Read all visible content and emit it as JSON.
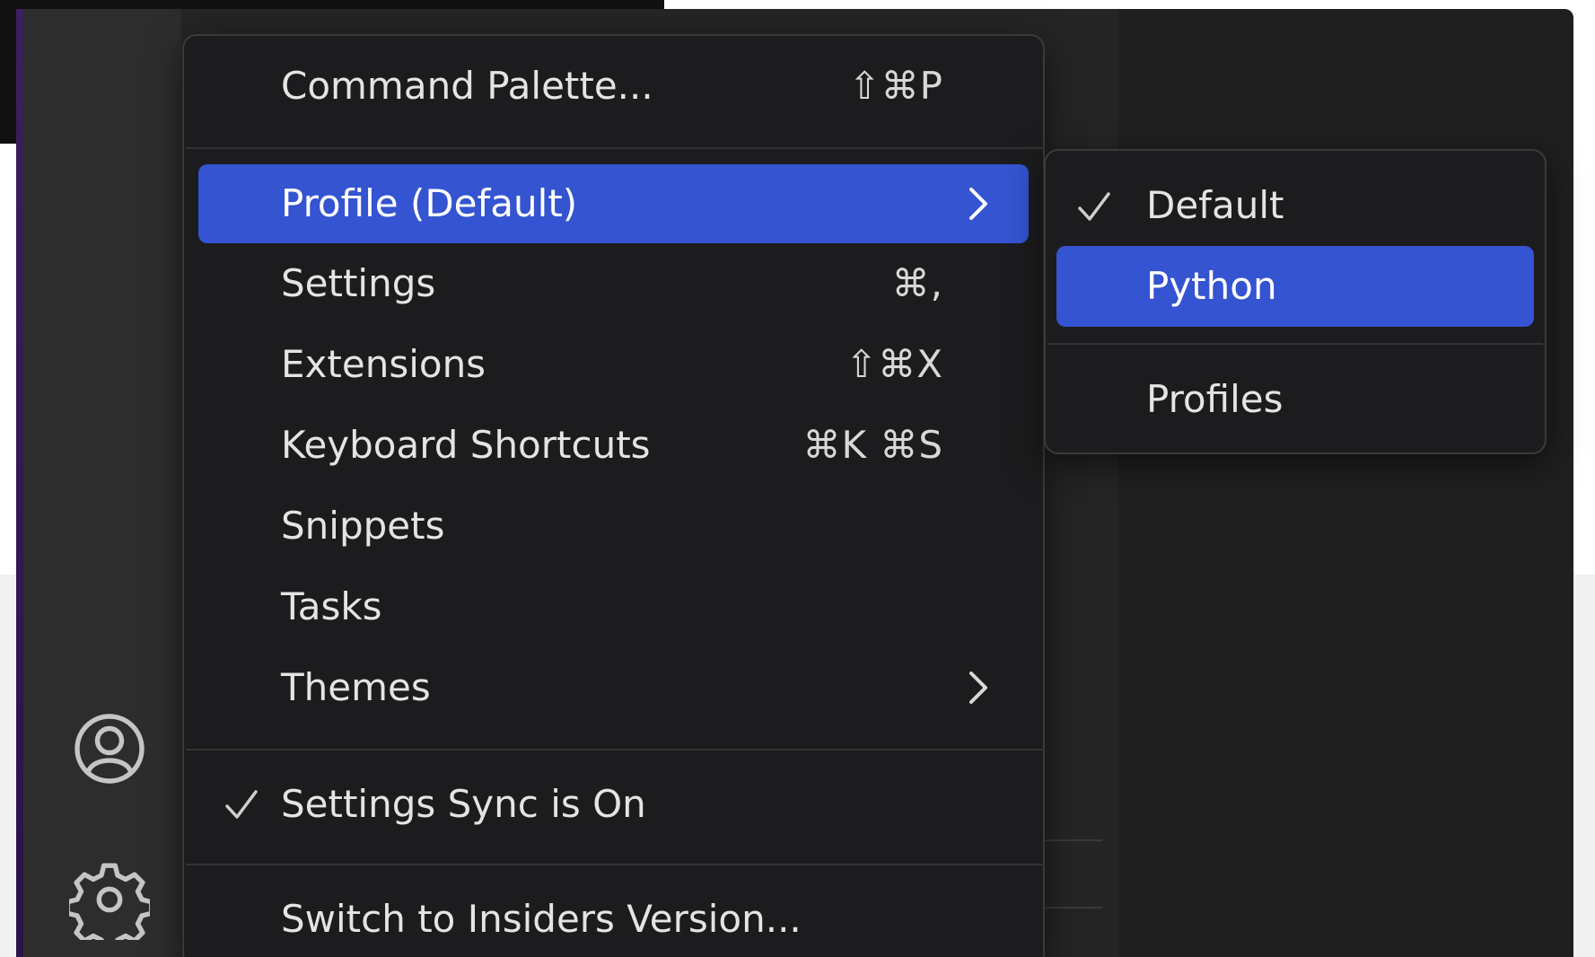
{
  "menu": {
    "items": [
      {
        "label": "Command Palette...",
        "shortcut": "⇧⌘P"
      },
      {
        "label": "Profile (Default)",
        "has_submenu": true,
        "highlighted": true
      },
      {
        "label": "Settings",
        "shortcut": "⌘,"
      },
      {
        "label": "Extensions",
        "shortcut": "⇧⌘X"
      },
      {
        "label": "Keyboard Shortcuts",
        "shortcut": "⌘K ⌘S"
      },
      {
        "label": "Snippets"
      },
      {
        "label": "Tasks"
      },
      {
        "label": "Themes",
        "has_submenu": true
      },
      {
        "label": "Settings Sync is On",
        "checked": true
      },
      {
        "label": "Switch to Insiders Version..."
      }
    ]
  },
  "submenu": {
    "items": [
      {
        "label": "Default",
        "checked": true
      },
      {
        "label": "Python",
        "highlighted": true
      },
      {
        "label": "Profiles"
      }
    ]
  },
  "activity_bar": {
    "icons": [
      "accounts-icon",
      "manage-gear-icon"
    ]
  },
  "colors": {
    "highlight": "#3454d1",
    "menu_bg": "#1c1c1e",
    "text": "#e4e4e4"
  }
}
